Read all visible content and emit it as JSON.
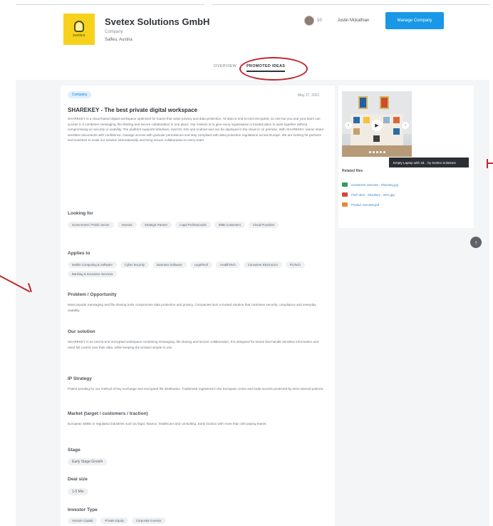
{
  "header": {
    "company_name": "Svetex Solutions GmbH",
    "company_type": "Company",
    "location": "Salfeu, Austria",
    "logo_text": "svetex",
    "user_meta": "10",
    "user_name": "Justin Mckathian",
    "manage_button": "Manage Company"
  },
  "tabs": [
    {
      "label": "OVERVIEW",
      "active": false
    },
    {
      "label": "PROMOTED IDEAS",
      "active": true
    }
  ],
  "post": {
    "badge": "Company",
    "date": "May 27, 2021",
    "title": "SHAREKEY - The best private digital workspace",
    "description": "SHAREKEY is a cloud-based digital workspace optimized for teams that value privacy and data protection. All data is end-to-end encrypted, no one but you and your team can access it. It combines messaging, file sharing and secure collaboration in one place. Our mission is to give every organisation a trusted place to work together without compromising on security or usability. The platform supports Windows, macOS, iOS and Android and can be deployed in the cloud or on premise. With SHAREKEY, teams share sensitive documents with confidence, manage access with granular permissions and stay compliant with data protection regulations across Europe. We are looking for partners and investors to scale our solution internationally and bring secure collaboration to every team."
  },
  "sections": {
    "looking_for": {
      "heading": "Looking for",
      "chips": [
        "Government / Public Sector",
        "Investor",
        "Strategic Partner",
        "Legal Professionals",
        "SMB Customers",
        "Cloud Providers"
      ]
    },
    "applies_to": {
      "heading": "Applies to",
      "chips": [
        "Mobile Computing & Software",
        "Cyber Security",
        "Business Software",
        "LegalTech",
        "HealthTech",
        "Consumer Electronics",
        "FinTech",
        "Banking & Insurance Services"
      ]
    },
    "problem": {
      "heading": "Problem / Opportunity",
      "text": "Most popular messaging and file sharing tools compromise data protection and privacy. Companies lack a trusted solution that combines security, compliance and everyday usability."
    },
    "solution": {
      "heading": "Our solution",
      "text": "SHAREKEY is an end-to-end encrypted workspace combining messaging, file sharing and secure collaboration. It is designed for teams that handle sensitive information and need full control over their data, while keeping the product simple to use."
    },
    "ip": {
      "heading": "IP Strategy",
      "text": "Patent pending for our method of key exchange and encrypted file distribution. Trademark registered in the European Union and trade secrets protected by strict internal policies."
    },
    "market": {
      "heading": "Market (target / customers / traction)",
      "text": "European SMBs in regulated industries such as legal, finance, healthcare and consulting. Early traction with more than 100 paying teams."
    },
    "stage": {
      "heading": "Stage",
      "value": "Early Stage Growth"
    },
    "deal_size": {
      "heading": "Deal size",
      "value": "1-5 Mio"
    },
    "investor_type": {
      "heading": "Investor Type",
      "chips": [
        "Venture Capital",
        "Private Equity",
        "Corporate Investor"
      ]
    }
  },
  "sidebar": {
    "tooltip": "Empty Laptop with 3d... by Svetex Solutions",
    "related_heading": "Related files",
    "files": [
      {
        "name": "Investment overview - Sharekey.jpg",
        "color": "#2f9e5c"
      },
      {
        "name": "Pitch deck - Sharekey - 2021.jpg",
        "color": "#d9443a"
      },
      {
        "name": "Product overview.pdf",
        "color": "#e8883a"
      }
    ]
  },
  "icons": {
    "scroll_top": "arrow-up-icon",
    "play": "play-icon",
    "prev": "chevron-left-icon",
    "next": "chevron-right-icon"
  },
  "colors": {
    "accent": "#1898e6",
    "annotation": "#c0272d",
    "logo": "#f6d21d"
  }
}
